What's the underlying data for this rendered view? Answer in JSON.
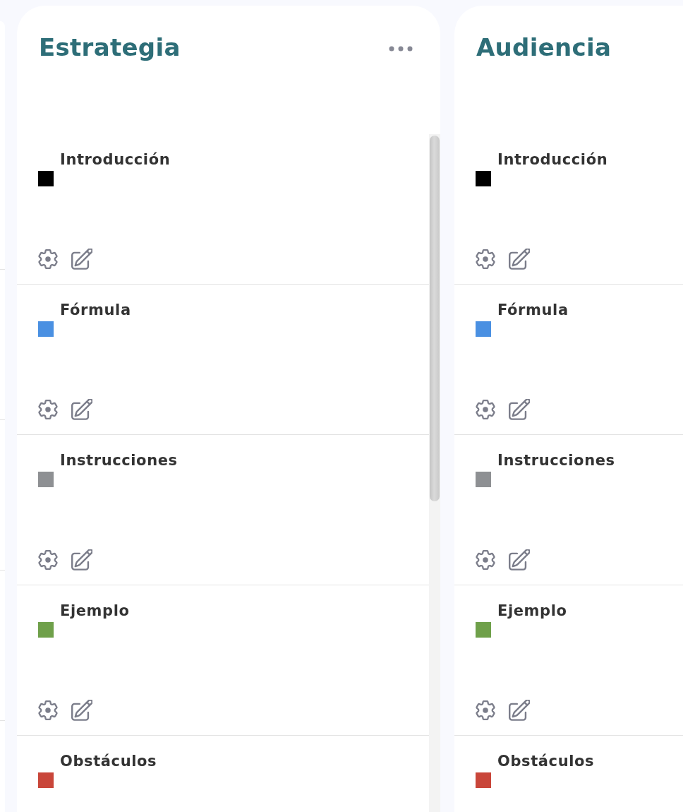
{
  "columns": [
    {
      "title": "Estrategia",
      "more_menu": true,
      "scrollbar": true,
      "rows": [
        {
          "title": "Introducción",
          "color": "#000000",
          "actions": true
        },
        {
          "title": "Fórmula",
          "color": "#4a90e2",
          "actions": true
        },
        {
          "title": "Instrucciones",
          "color": "#8e9093",
          "actions": true
        },
        {
          "title": "Ejemplo",
          "color": "#6fa04a",
          "actions": true
        },
        {
          "title": "Obstáculos",
          "color": "#c9463a",
          "actions": false
        }
      ]
    },
    {
      "title": "Audiencia",
      "more_menu": false,
      "scrollbar": false,
      "rows": [
        {
          "title": "Introducción",
          "color": "#000000",
          "actions": true
        },
        {
          "title": "Fórmula",
          "color": "#4a90e2",
          "actions": true
        },
        {
          "title": "Instrucciones",
          "color": "#8e9093",
          "actions": true
        },
        {
          "title": "Ejemplo",
          "color": "#6fa04a",
          "actions": true
        },
        {
          "title": "Obstáculos",
          "color": "#c9463a",
          "actions": false
        }
      ]
    }
  ]
}
